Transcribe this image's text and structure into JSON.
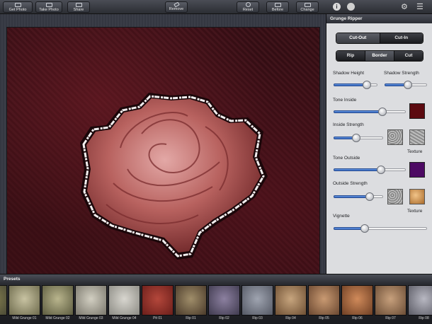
{
  "toolbar": {
    "get_photo": "Get Photo",
    "take_photo": "Take Photo",
    "share": "Share",
    "remove": "Remove",
    "reset": "Reset",
    "before": "Before",
    "change": "Change",
    "info_glyph": "i",
    "settings_glyph": "⚙",
    "list_glyph": "☰"
  },
  "panel": {
    "title": "Grunge Ripper",
    "mode": {
      "options": [
        "Cut-Out",
        "Cut-In"
      ],
      "selected": "Cut-Out"
    },
    "edge": {
      "options": [
        "Rip",
        "Border",
        "Cut"
      ],
      "selected": "Border"
    },
    "shadow_height": {
      "label": "Shadow Height",
      "value": 0.75
    },
    "shadow_strength": {
      "label": "Shadow Strength",
      "value": 0.55
    },
    "tone_inside": {
      "label": "Tone Inside",
      "value": 0.68,
      "color": "#5c0a10"
    },
    "inside_strength": {
      "label": "Inside Strength",
      "value": 0.45,
      "texture_label": "Texture"
    },
    "tone_outside": {
      "label": "Tone Outside",
      "value": 0.66,
      "color": "#4d0a63"
    },
    "outside_strength": {
      "label": "Outside Strength",
      "value": 0.73,
      "texture_label": "Texture"
    },
    "vignette": {
      "label": "Vignette",
      "value": 0.33
    }
  },
  "presets": {
    "title": "Presets",
    "items": [
      {
        "label": "",
        "c1": "#8a8452",
        "c2": "#4b4a36"
      },
      {
        "label": "Mild Grunge 01",
        "c1": "#c8c3a2",
        "c2": "#6d6a4c"
      },
      {
        "label": "Mild Grunge 02",
        "c1": "#b9b58d",
        "c2": "#5c5b3f"
      },
      {
        "label": "Mild Grunge 03",
        "c1": "#d2cfc2",
        "c2": "#7a776c"
      },
      {
        "label": "Mild Grunge 04",
        "c1": "#d8d6cf",
        "c2": "#8c8b84"
      },
      {
        "label": "Pit 01",
        "c1": "#b4473b",
        "c2": "#6b1e1a"
      },
      {
        "label": "Rip 01",
        "c1": "#a08e6a",
        "c2": "#4a3a2a"
      },
      {
        "label": "Rip 02",
        "c1": "#8c80a0",
        "c2": "#3f3a4e"
      },
      {
        "label": "Rip 03",
        "c1": "#9fa4b0",
        "c2": "#545864"
      },
      {
        "label": "Rip 04",
        "c1": "#c7a57e",
        "c2": "#6e4f33"
      },
      {
        "label": "Rip 05",
        "c1": "#c99a72",
        "c2": "#6a4730"
      },
      {
        "label": "Rip 06",
        "c1": "#d08a5a",
        "c2": "#6e3f24"
      },
      {
        "label": "Rip 07",
        "c1": "#c7a07c",
        "c2": "#6b4d36"
      },
      {
        "label": "Rip 08",
        "c1": "#b8b8c2",
        "c2": "#5a5a64"
      }
    ]
  }
}
